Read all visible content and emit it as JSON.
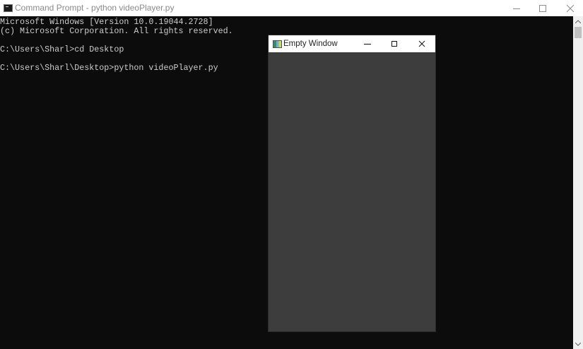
{
  "cmd_window": {
    "title": "Command Prompt - python  videoPlayer.py",
    "icon": "cmd-console-icon"
  },
  "console": {
    "lines": [
      "Microsoft Windows [Version 10.0.19044.2728]",
      "(c) Microsoft Corporation. All rights reserved.",
      "",
      "C:\\Users\\Sharl>cd Desktop",
      "",
      "C:\\Users\\Sharl\\Desktop>python videoPlayer.py"
    ]
  },
  "empty_window": {
    "title": "Empty Window",
    "icon": "app-window-icon"
  },
  "colors": {
    "console_bg": "#0c0c0c",
    "console_text": "#cccccc",
    "empty_window_client": "#3d3d3d"
  }
}
